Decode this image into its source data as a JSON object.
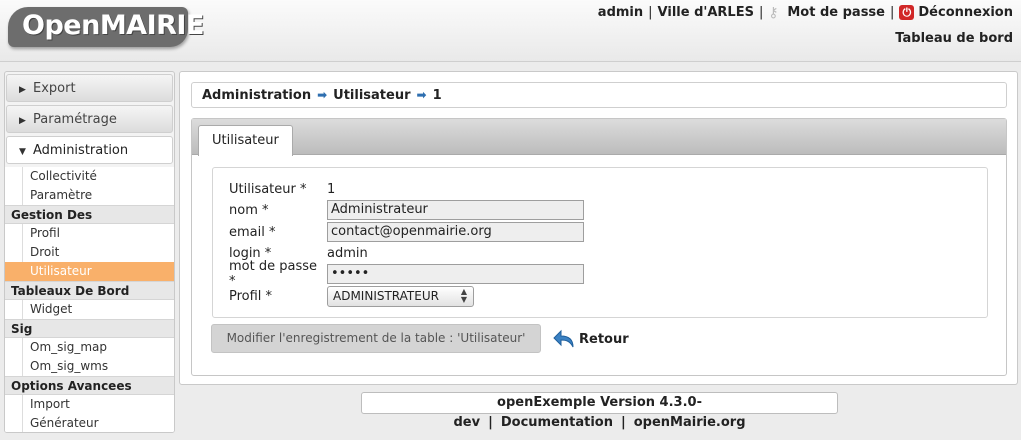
{
  "header": {
    "logo_text": "OpenMAIRIE",
    "user": "admin",
    "city": "Ville d'ARLES",
    "password_link": "Mot de passe",
    "logout_link": "Déconnexion",
    "dashboard_link": "Tableau de bord"
  },
  "sidebar": {
    "blocks": [
      {
        "label": "Export"
      },
      {
        "label": "Paramétrage"
      },
      {
        "label": "Administration"
      }
    ],
    "admin_items": [
      {
        "type": "item",
        "label": "Collectivité"
      },
      {
        "type": "item",
        "label": "Paramètre"
      },
      {
        "type": "cat",
        "label": "Gestion Des Utilisateurs"
      },
      {
        "type": "item",
        "label": "Profil"
      },
      {
        "type": "item",
        "label": "Droit"
      },
      {
        "type": "item",
        "label": "Utilisateur"
      },
      {
        "type": "cat",
        "label": "Tableaux De Bord"
      },
      {
        "type": "item",
        "label": "Widget"
      },
      {
        "type": "cat",
        "label": "Sig"
      },
      {
        "type": "item",
        "label": "Om_sig_map"
      },
      {
        "type": "item",
        "label": "Om_sig_wms"
      },
      {
        "type": "cat",
        "label": "Options Avancees"
      },
      {
        "type": "item",
        "label": "Import"
      },
      {
        "type": "item",
        "label": "Générateur"
      }
    ]
  },
  "breadcrumb": [
    "Administration",
    "Utilisateur",
    "1"
  ],
  "tab_label": "Utilisateur",
  "form": {
    "utilisateur": {
      "label": "Utilisateur *",
      "value": "1"
    },
    "nom": {
      "label": "nom *",
      "value": "Administrateur"
    },
    "email": {
      "label": "email *",
      "value": "contact@openmairie.org"
    },
    "login": {
      "label": "login *",
      "value": "admin"
    },
    "password": {
      "label": "mot de passe *",
      "value": "•••••"
    },
    "profil": {
      "label": "Profil *",
      "value": "ADMINISTRATEUR"
    }
  },
  "actions": {
    "submit_label": "Modifier l'enregistrement de la table : 'Utilisateur'",
    "back_label": "Retour"
  },
  "footer": {
    "version": "openExemple Version 4.3.0-dev",
    "documentation": "Documentation",
    "site": "openMairie.org"
  },
  "colors": {
    "selected_menu": "#f9b06a",
    "breadcrumb_arrow": "#2f6fb0",
    "logout_icon": "#d12828"
  }
}
